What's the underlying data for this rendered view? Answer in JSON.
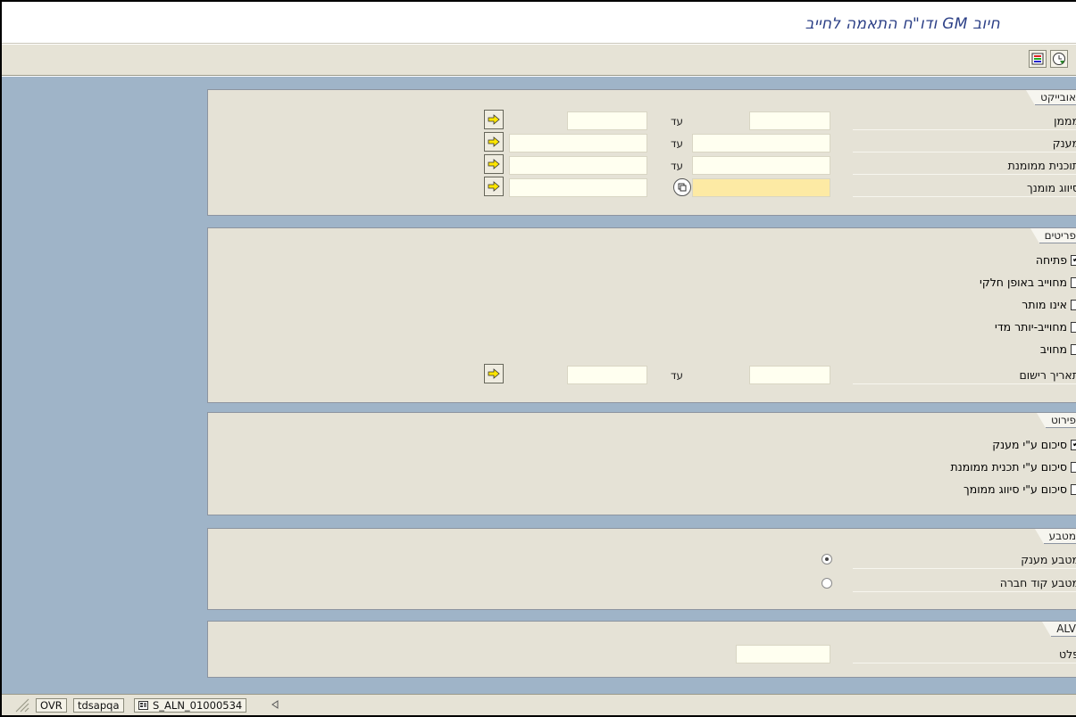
{
  "title": "חיוב GM ודו\"ח התאמה לחייב",
  "toolbar": {
    "icon1": "color-legend-icon",
    "icon2": "execute-clock-icon"
  },
  "sections": {
    "object": {
      "title": "אובייקט",
      "rows": [
        {
          "label": "מממן",
          "to": "עד"
        },
        {
          "label": "מענק",
          "to": "עד"
        },
        {
          "label": "תוכנית ממומנת",
          "to": "עד"
        },
        {
          "label": "סיווג מומנך"
        }
      ]
    },
    "items": {
      "title": "פריטים",
      "checks": [
        {
          "label": "פתיחה",
          "checked": true
        },
        {
          "label": "מחוייב באופן חלקי",
          "checked": false
        },
        {
          "label": "אינו מותר",
          "checked": false
        },
        {
          "label": "מחוייב-יותר מדי",
          "checked": false
        },
        {
          "label": "מחויב",
          "checked": false
        }
      ],
      "date_label": "תאריך רישום",
      "to": "עד"
    },
    "detail": {
      "title": "פירוט",
      "checks": [
        {
          "label": "סיכום ע\"י מענק",
          "checked": true
        },
        {
          "label": "סיכום ע\"י תכנית ממומנת",
          "checked": false
        },
        {
          "label": "סיכום ע\"י סיווג ממומך",
          "checked": false
        }
      ]
    },
    "currency": {
      "title": "מטבע",
      "radios": [
        {
          "label": "מטבע מענק",
          "selected": true
        },
        {
          "label": "מטבע קוד חברה",
          "selected": false
        }
      ]
    },
    "alv": {
      "title": "ALV",
      "layout_label": "פלט"
    }
  },
  "status": {
    "mode": "OVR",
    "server": "tdsapqa",
    "session": "S_ALN_01000534"
  }
}
